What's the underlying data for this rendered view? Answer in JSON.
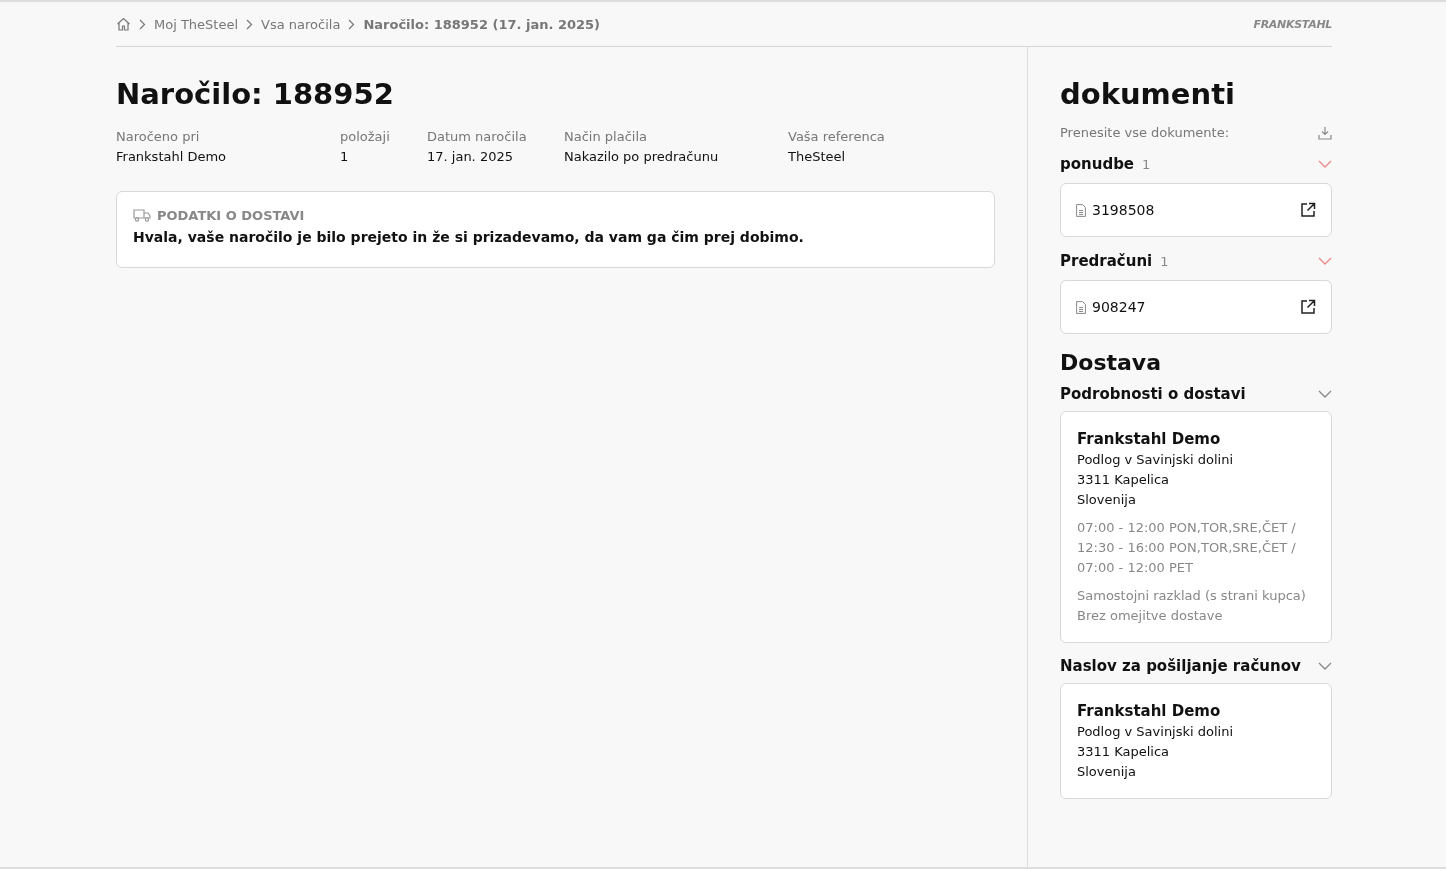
{
  "breadcrumb": [
    {
      "label": "Moj TheSteel",
      "current": false
    },
    {
      "label": "Vsa naročila",
      "current": false
    },
    {
      "label": "Naročilo: 188952 (17. jan. 2025)",
      "current": true
    }
  ],
  "logo": "FRANKSTAHL",
  "order": {
    "title": "Naročilo: 188952",
    "meta": [
      {
        "label": "Naročeno pri",
        "value": "Frankstahl Demo"
      },
      {
        "label": "položaji",
        "value": "1"
      },
      {
        "label": "Datum naročila",
        "value": "17. jan. 2025"
      },
      {
        "label": "Način plačila",
        "value": "Nakazilo po predračunu"
      },
      {
        "label": "Vaša referenca",
        "value": "TheSteel"
      }
    ],
    "delivery_notice": {
      "heading": "PODATKI O DOSTAVI",
      "message": "Hvala, vaše naročilo je bilo prejeto in že si prizadevamo, da vam ga čim prej dobimo."
    }
  },
  "documents": {
    "title": "dokumenti",
    "download_all": "Prenesite vse dokumente:",
    "groups": [
      {
        "name": "ponudbe",
        "count": "1",
        "expanded": true,
        "items": [
          "3198508"
        ]
      },
      {
        "name": "Predračuni",
        "count": "1",
        "expanded": true,
        "items": [
          "908247"
        ]
      }
    ]
  },
  "delivery": {
    "title": "Dostava",
    "sections": [
      {
        "name": "Podrobnosti o dostavi",
        "expanded": true,
        "company": "Frankstahl Demo",
        "address": [
          "Podlog v Savinjski dolini",
          "3311 Kapelica",
          "Slovenija"
        ],
        "hours": [
          "07:00 - 12:00 PON,TOR,SRE,ČET /",
          "12:30 - 16:00 PON,TOR,SRE,ČET /",
          "07:00 - 12:00 PET"
        ],
        "notes": [
          "Samostojni razklad (s strani kupca)",
          "Brez omejitve dostave"
        ]
      },
      {
        "name": "Naslov za pošiljanje računov",
        "expanded": true,
        "company": "Frankstahl Demo",
        "address": [
          "Podlog v Savinjski dolini",
          "3311 Kapelica",
          "Slovenija"
        ]
      }
    ]
  }
}
